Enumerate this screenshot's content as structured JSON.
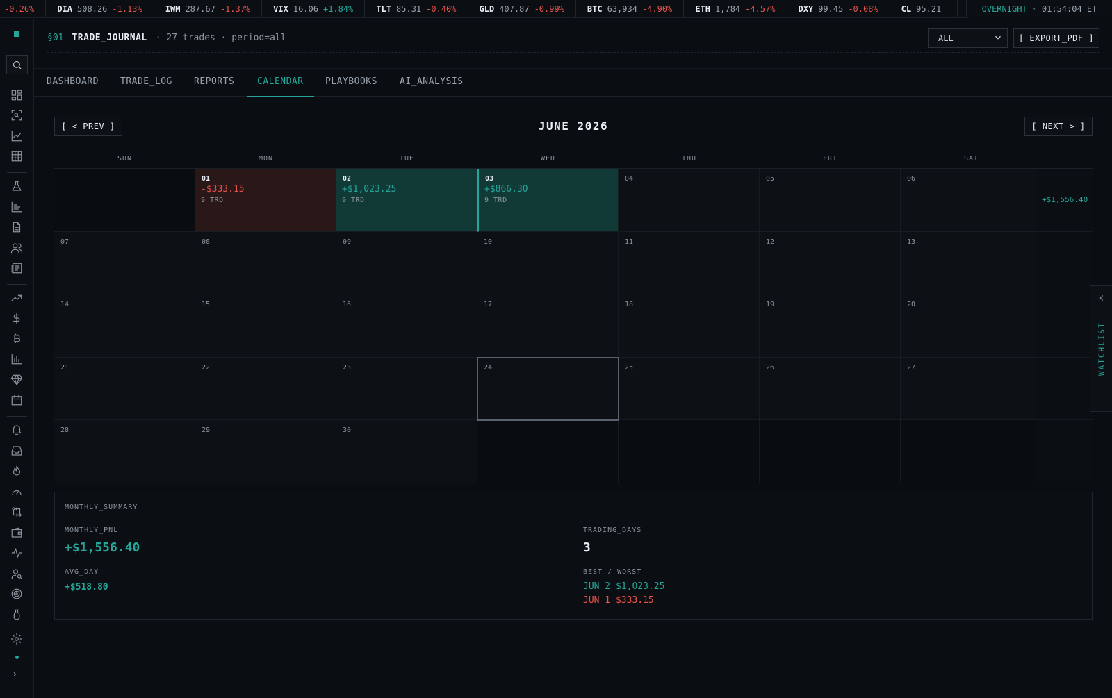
{
  "ticker": {
    "lead_change": "-0.26%",
    "items": [
      {
        "symbol": "DIA",
        "price": "508.26",
        "change": "-1.13%",
        "dir": "neg"
      },
      {
        "symbol": "IWM",
        "price": "287.67",
        "change": "-1.37%",
        "dir": "neg"
      },
      {
        "symbol": "VIX",
        "price": "16.06",
        "change": "+1.84%",
        "dir": "pos"
      },
      {
        "symbol": "TLT",
        "price": "85.31",
        "change": "-0.40%",
        "dir": "neg"
      },
      {
        "symbol": "GLD",
        "price": "407.87",
        "change": "-0.99%",
        "dir": "neg"
      },
      {
        "symbol": "BTC",
        "price": "63,934",
        "change": "-4.90%",
        "dir": "neg"
      },
      {
        "symbol": "ETH",
        "price": "1,784",
        "change": "-4.57%",
        "dir": "neg"
      },
      {
        "symbol": "DXY",
        "price": "99.45",
        "change": "-0.08%",
        "dir": "neg"
      },
      {
        "symbol": "CL",
        "price": "95.21",
        "change": "",
        "dir": "neg"
      }
    ],
    "session": "OVERNIGHT",
    "separator": "·",
    "clock": "01:54:04 ET"
  },
  "header": {
    "section": "§01",
    "title": "TRADE_JOURNAL",
    "meta": "· 27 trades · period=all",
    "period_value": "ALL",
    "export_label": "[ EXPORT_PDF ]"
  },
  "tabs": [
    {
      "label": "DASHBOARD"
    },
    {
      "label": "TRADE_LOG"
    },
    {
      "label": "REPORTS"
    },
    {
      "label": "CALENDAR"
    },
    {
      "label": "PLAYBOOKS"
    },
    {
      "label": "AI_ANALYSIS"
    }
  ],
  "active_tab": "CALENDAR",
  "calendar": {
    "prev_label": "[ < PREV ]",
    "next_label": "[ NEXT > ]",
    "month_label": "JUNE 2026",
    "weekdays": [
      "SUN",
      "MON",
      "TUE",
      "WED",
      "THU",
      "FRI",
      "SAT"
    ],
    "weeks": [
      {
        "total": "+$1,556.40",
        "days": [
          {
            "day": ""
          },
          {
            "day": "01",
            "pnl": "-$333.15",
            "trades": "9 TRD",
            "result": "loss"
          },
          {
            "day": "02",
            "pnl": "+$1,023.25",
            "trades": "9 TRD",
            "result": "win"
          },
          {
            "day": "03",
            "pnl": "+$866.30",
            "trades": "9 TRD",
            "result": "win"
          },
          {
            "day": "04"
          },
          {
            "day": "05"
          },
          {
            "day": "06"
          }
        ]
      },
      {
        "total": "",
        "days": [
          {
            "day": "07"
          },
          {
            "day": "08"
          },
          {
            "day": "09"
          },
          {
            "day": "10"
          },
          {
            "day": "11"
          },
          {
            "day": "12"
          },
          {
            "day": "13"
          }
        ]
      },
      {
        "total": "",
        "days": [
          {
            "day": "14"
          },
          {
            "day": "15"
          },
          {
            "day": "16"
          },
          {
            "day": "17"
          },
          {
            "day": "18"
          },
          {
            "day": "19"
          },
          {
            "day": "20"
          }
        ]
      },
      {
        "total": "",
        "days": [
          {
            "day": "21"
          },
          {
            "day": "22"
          },
          {
            "day": "23"
          },
          {
            "day": "24",
            "selected": true
          },
          {
            "day": "25"
          },
          {
            "day": "26"
          },
          {
            "day": "27"
          }
        ]
      },
      {
        "total": "",
        "days": [
          {
            "day": "28"
          },
          {
            "day": "29"
          },
          {
            "day": "30"
          },
          {
            "day": ""
          },
          {
            "day": ""
          },
          {
            "day": ""
          },
          {
            "day": ""
          }
        ]
      }
    ]
  },
  "watchlist": {
    "label": "WATCHLIST"
  },
  "summary": {
    "title": "MONTHLY_SUMMARY",
    "monthly_pnl_label": "MONTHLY_PNL",
    "monthly_pnl": "+$1,556.40",
    "trading_days_label": "TRADING_DAYS",
    "trading_days": "3",
    "avg_day_label": "AVG_DAY",
    "avg_day": "+$518.80",
    "best_worst_label": "BEST / WORST",
    "best": "JUN 2 $1,023.25",
    "worst": "JUN 1 $333.15"
  },
  "colors": {
    "accent": "#26a69a",
    "negative": "#e5534b",
    "win_cell": "#113a37",
    "loss_cell": "#2a1819"
  },
  "rail_icons": [
    "logo-mark",
    "search-icon",
    "dashboard-grid-icon",
    "scan-icon",
    "line-chart-icon",
    "table-grid-icon",
    "flask-icon",
    "bar-chart-icon",
    "document-icon",
    "users-icon",
    "newspaper-icon",
    "trending-up-icon",
    "dollar-icon",
    "bitcoin-icon",
    "column-chart-icon",
    "gem-icon",
    "calendar-icon",
    "bell-icon",
    "inbox-icon",
    "flame-icon",
    "gauge-icon",
    "swap-icon",
    "wallet-icon",
    "activity-icon",
    "user-search-icon",
    "target-icon",
    "beaker-icon",
    "settings-icon",
    "expand-icon"
  ]
}
